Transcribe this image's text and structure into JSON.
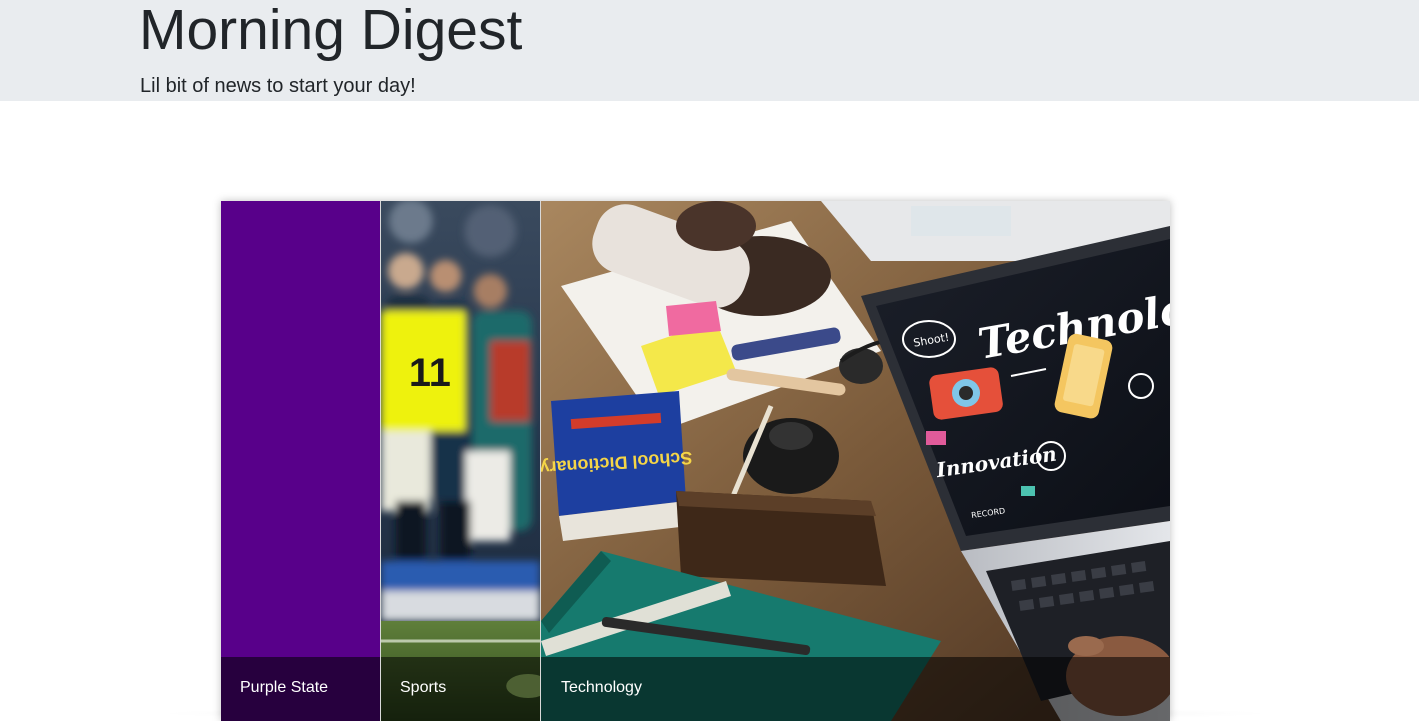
{
  "header": {
    "title": "Morning Digest",
    "tagline": "Lil bit of news to start your day!"
  },
  "accordion": {
    "panels": [
      {
        "label": "Purple State",
        "color": "#58008a"
      },
      {
        "label": "Sports"
      },
      {
        "label": "Technology",
        "image_text": {
          "laptop_headline": "Technolog",
          "laptop_word": "Innovation",
          "laptop_bubble": "Shoot!",
          "laptop_small": "RECORD",
          "book_title": "School Dictionary",
          "jersey_number": "11"
        }
      }
    ]
  },
  "colors": {
    "header_bg": "#e9ecef",
    "caption_bg": "rgba(0,0,0,0.55)",
    "caption_text": "#ffffff"
  }
}
